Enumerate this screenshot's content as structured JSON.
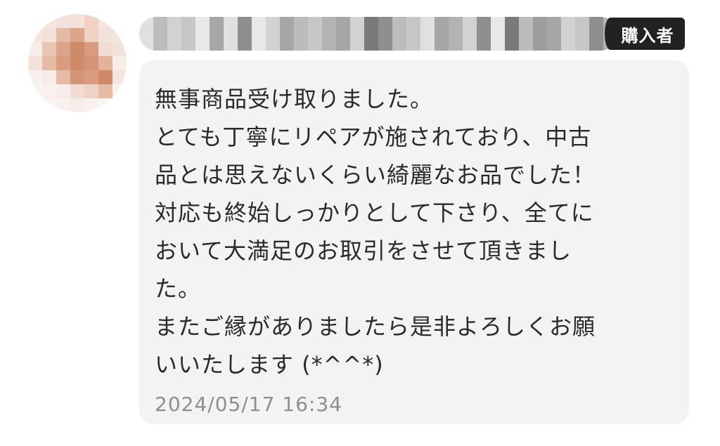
{
  "header": {
    "badge_label": "購入者"
  },
  "message": {
    "lines": [
      "無事商品受け取りました。",
      "とても丁寧にリペアが施されており、中古",
      "品とは思えないくらい綺麗なお品でした！",
      "対応も終始しっかりとして下さり、全てに",
      "おいて大満足のお取引をさせて頂きまし",
      "た。",
      "またご縁がありましたら是非よろしくお願",
      "いいたします (*^^*)"
    ],
    "timestamp": "2024/05/17 16:34"
  },
  "colors": {
    "bubble_background": "#f3f3f3",
    "badge_background": "#222222",
    "text": "#2a2a2a",
    "timestamp": "#8e8e8e"
  }
}
